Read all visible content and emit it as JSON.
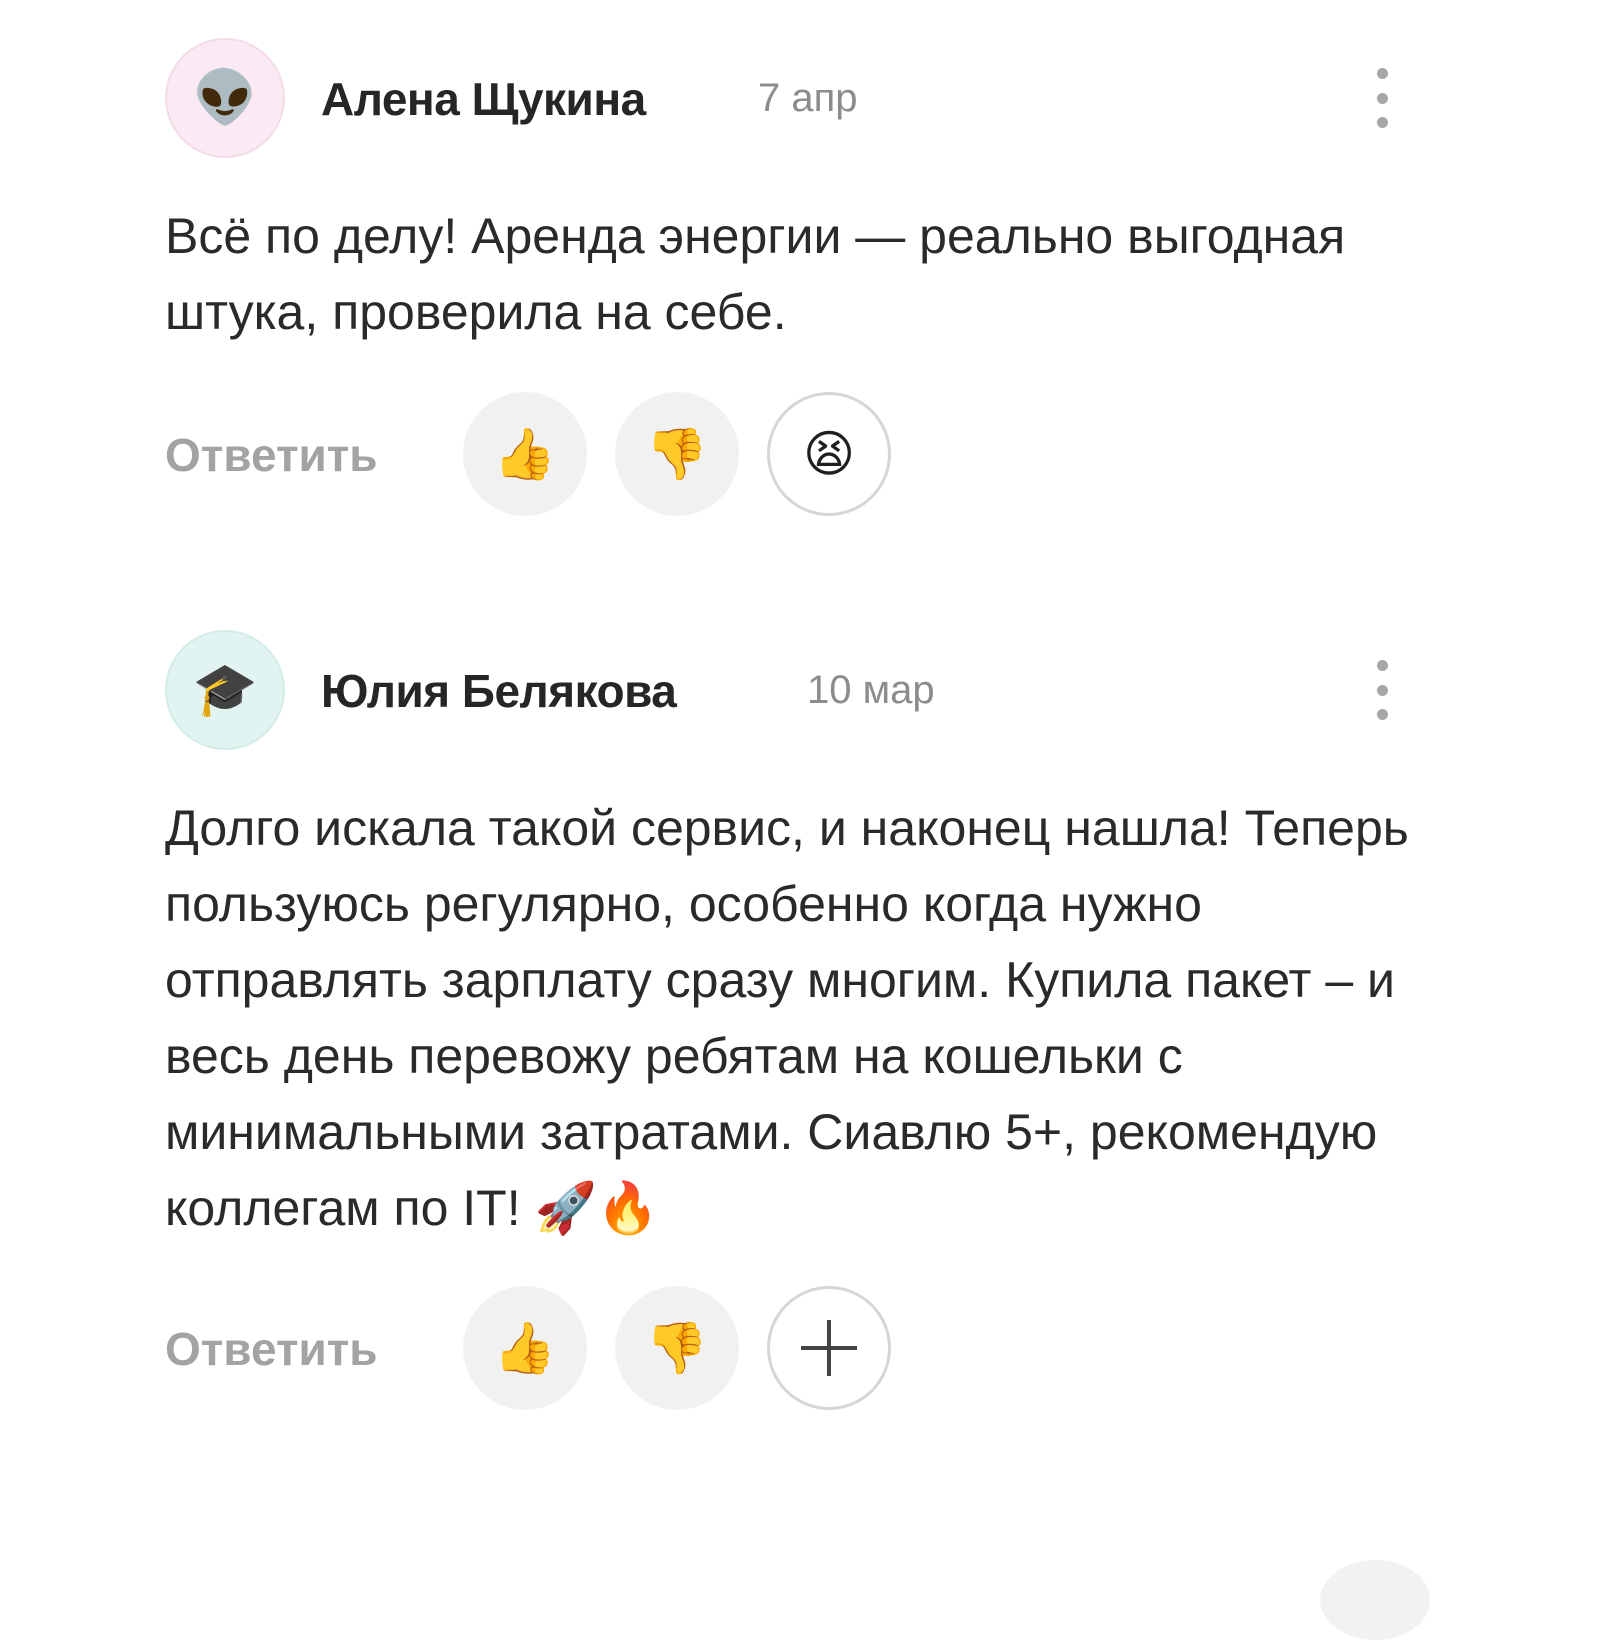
{
  "comments": [
    {
      "author": "Алена Щукина",
      "date": "7 апр",
      "avatar_icon": "alien-face-icon",
      "avatar_glyph": "👽",
      "text": "Всё по делу! Аренда энергии — реально выгодная штука, проверила на себе.",
      "reply_label": "Ответить",
      "reactions": {
        "like_glyph": "👍",
        "dislike_glyph": "👎",
        "extra_glyph": "😫",
        "extra_icon": "tired-face-icon"
      }
    },
    {
      "author": "Юлия Белякова",
      "date": "10 мар",
      "avatar_icon": "graduation-cap-icon",
      "avatar_glyph": "🎓",
      "text": "Долго искала такой сервис, и наконец нашла! Теперь пользуюсь регулярно, особенно когда нужно отправлять зарплату сразу многим. Купила пакет – и весь день перевожу ребятам на кошельки с минимальными затратами. Сиавлю 5+, рекомендую коллегам по IT! 🚀🔥",
      "reply_label": "Ответить",
      "reactions": {
        "like_glyph": "👍",
        "dislike_glyph": "👎",
        "extra_icon": "plus-icon"
      }
    }
  ]
}
